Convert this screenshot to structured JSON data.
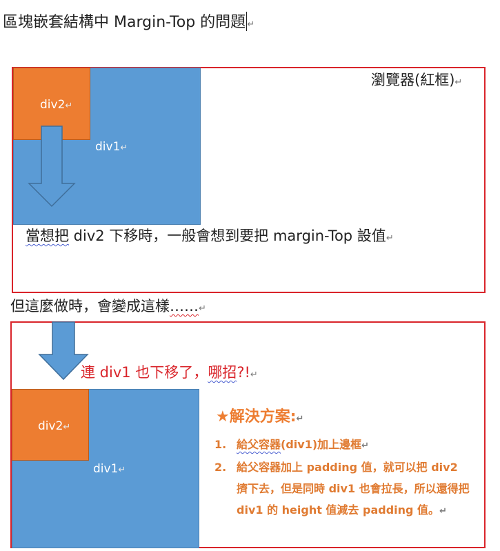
{
  "title": "區塊嵌套結構中 Margin-Top 的問題",
  "para_mark": "↵",
  "box1": {
    "browser_label": "瀏覽器(紅框)",
    "div2_label": "div2",
    "div1_label": "div1",
    "caption_underlined": "當想把",
    "caption_rest": " div2 下移時，一般會想到要把 margin-Top 設值"
  },
  "between_text": "但這麼做時，會變成這樣",
  "between_ellipsis": "……",
  "box2": {
    "note_part1": "連 div1 也下移了，",
    "note_underlined": "哪招",
    "note_part2": "?!",
    "div2_label": "div2",
    "div1_label": "div1",
    "solution_star": "★",
    "solution_title": "解決方案:",
    "solutions": [
      {
        "num": "1.",
        "text_a": "給父容器",
        "text_b": "(div1)加上邊框"
      },
      {
        "num": "2.",
        "text_a": "給父容器加上 padding 值，就可以把 div2 擠下去，但是同時 div1 也會拉長，所以還得把 div1 的 height 值減去 padding 值。",
        "text_b": ""
      }
    ]
  },
  "colors": {
    "red_border": "#d9242a",
    "blue_box": "#5b9bd5",
    "orange_box": "#ed7d31",
    "solution_text": "#e07b32",
    "note_red": "#d9242a"
  }
}
